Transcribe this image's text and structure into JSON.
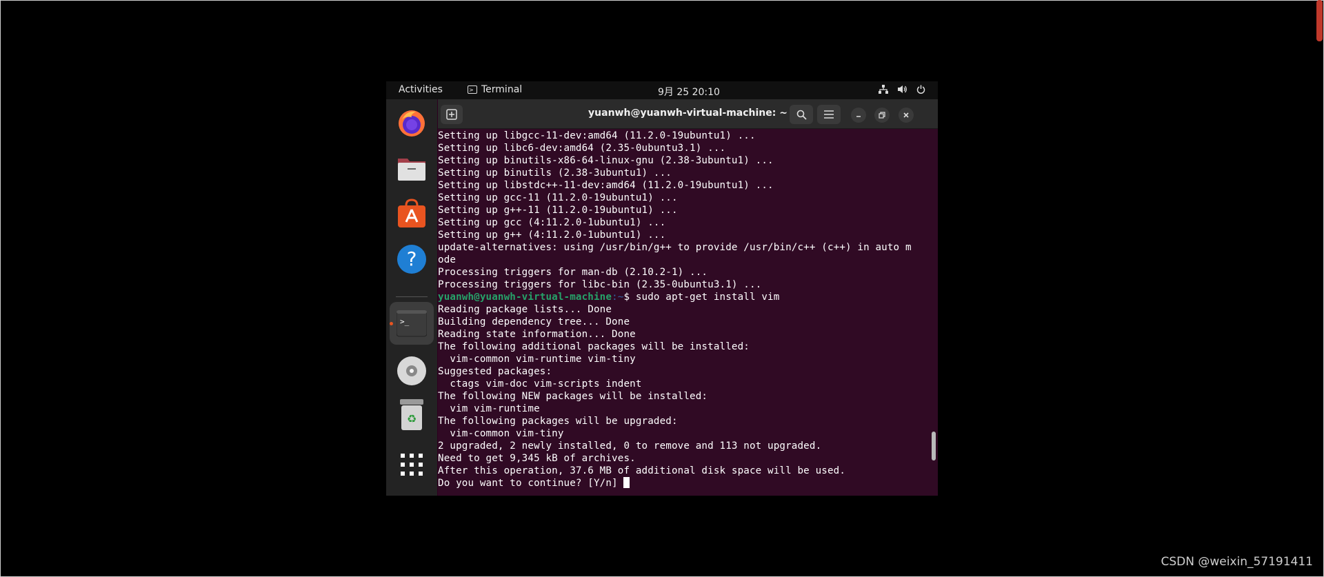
{
  "topbar": {
    "activities": "Activities",
    "app_name": "Terminal",
    "clock": "9月 25  20:10"
  },
  "window": {
    "title": "yuanwh@yuanwh-virtual-machine: ~"
  },
  "terminal": {
    "lines": [
      "Setting up libgcc-11-dev:amd64 (11.2.0-19ubuntu1) ...",
      "Setting up libc6-dev:amd64 (2.35-0ubuntu3.1) ...",
      "Setting up binutils-x86-64-linux-gnu (2.38-3ubuntu1) ...",
      "Setting up binutils (2.38-3ubuntu1) ...",
      "Setting up libstdc++-11-dev:amd64 (11.2.0-19ubuntu1) ...",
      "Setting up gcc-11 (11.2.0-19ubuntu1) ...",
      "Setting up g++-11 (11.2.0-19ubuntu1) ...",
      "Setting up gcc (4:11.2.0-1ubuntu1) ...",
      "Setting up g++ (4:11.2.0-1ubuntu1) ...",
      "update-alternatives: using /usr/bin/g++ to provide /usr/bin/c++ (c++) in auto m",
      "ode",
      "Processing triggers for man-db (2.10.2-1) ...",
      "Processing triggers for libc-bin (2.35-0ubuntu3.1) ..."
    ],
    "prompt_user": "yuanwh@yuanwh-virtual-machine",
    "prompt_path": ":~",
    "prompt_command": "$ sudo apt-get install vim",
    "lines_after": [
      "Reading package lists... Done",
      "Building dependency tree... Done",
      "Reading state information... Done",
      "The following additional packages will be installed:",
      "  vim-common vim-runtime vim-tiny",
      "Suggested packages:",
      "  ctags vim-doc vim-scripts indent",
      "The following NEW packages will be installed:",
      "  vim vim-runtime",
      "The following packages will be upgraded:",
      "  vim-common vim-tiny",
      "2 upgraded, 2 newly installed, 0 to remove and 113 not upgraded.",
      "Need to get 9,345 kB of archives.",
      "After this operation, 37.6 MB of additional disk space will be used."
    ],
    "final_prompt": "Do you want to continue? [Y/n] "
  },
  "watermark": "CSDN @weixin_57191411",
  "colors": {
    "terminal_bg": "#300a24",
    "prompt_user": "#26a269",
    "accent": "#e95420"
  }
}
